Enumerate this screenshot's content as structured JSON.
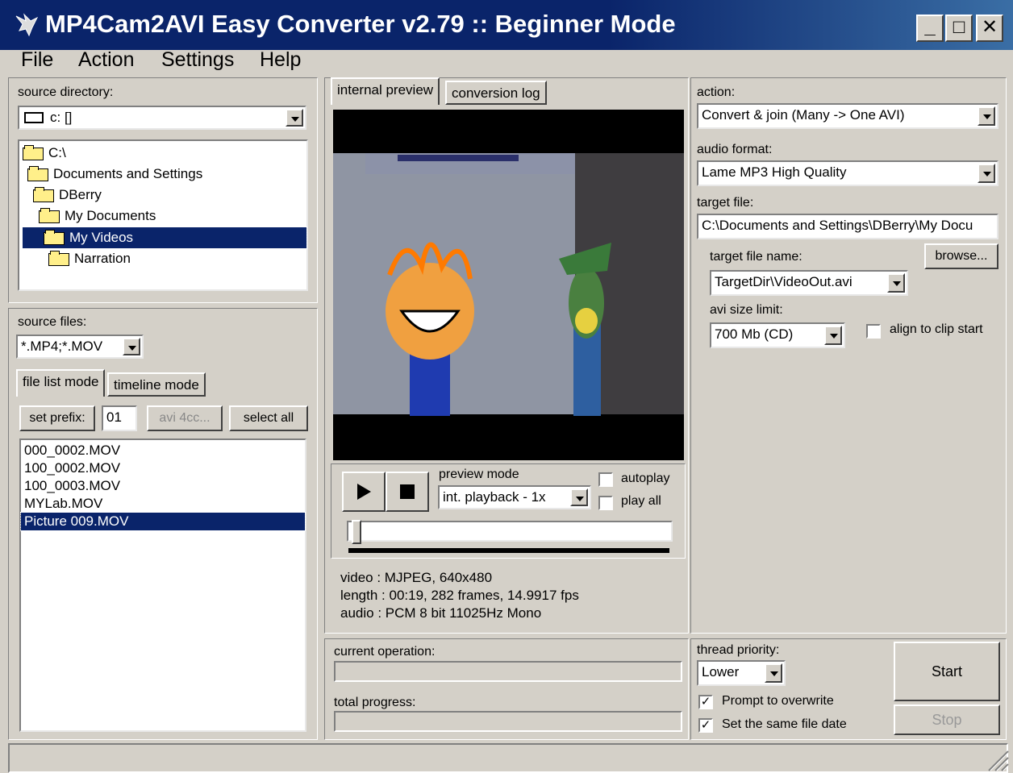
{
  "window": {
    "title": "MP4Cam2AVI Easy Converter v2.79 :: Beginner Mode",
    "minimize": "_",
    "maximize": "□",
    "close": "✕"
  },
  "menu": {
    "file": "File",
    "action": "Action",
    "settings": "Settings",
    "help": "Help"
  },
  "left": {
    "source_directory_label": "source directory:",
    "drive_value": "c: []",
    "tree": [
      "C:\\",
      "Documents and Settings",
      "DBerry",
      "My Documents",
      "My Videos",
      "Narration"
    ],
    "source_files_label": "source files:",
    "source_files_value": "*.MP4;*.MOV",
    "tab_file_list": "file list mode",
    "tab_timeline": "timeline mode",
    "set_prefix": "set prefix:",
    "prefix_value": "01",
    "avi_4cc": "avi 4cc...",
    "select_all": "select all",
    "files": [
      "000_0002.MOV",
      "100_0002.MOV",
      "100_0003.MOV",
      "MYLab.MOV",
      "Picture 009.MOV"
    ]
  },
  "center": {
    "tab_preview": "internal preview",
    "tab_log": "conversion log",
    "preview_mode_label": "preview mode",
    "preview_mode_value": "int. playback - 1x",
    "autoplay": "autoplay",
    "play_all": "play all",
    "info_video": "video  : MJPEG, 640x480",
    "info_length": "length : 00:19, 282 frames, 14.9917 fps",
    "info_audio": "audio  : PCM 8 bit 11025Hz Mono",
    "current_operation": "current operation:",
    "total_progress": "total progress:",
    "seek_position": 0.01
  },
  "right": {
    "action_label": "action:",
    "action_value": "Convert & join (Many -> One AVI)",
    "audio_format_label": "audio format:",
    "audio_format_value": "Lame MP3 High Quality",
    "target_file_label": "target file:",
    "target_file_value": "C:\\Documents and Settings\\DBerry\\My Docu",
    "target_file_name_label": "target file name:",
    "browse": "browse...",
    "target_file_name_value": "TargetDir\\VideoOut.avi",
    "avi_size_limit_label": "avi size limit:",
    "avi_size_limit_value": "700 Mb (CD)",
    "align_to_clip_start": "align to clip start",
    "thread_priority_label": "thread priority:",
    "thread_priority_value": "Lower",
    "prompt_overwrite": "Prompt to overwrite",
    "same_file_date": "Set the same file date",
    "start": "Start",
    "stop": "Stop"
  },
  "colors": {
    "title_bar": "#0a246a",
    "selection": "#0a246a",
    "face": "#d4d0c8"
  }
}
